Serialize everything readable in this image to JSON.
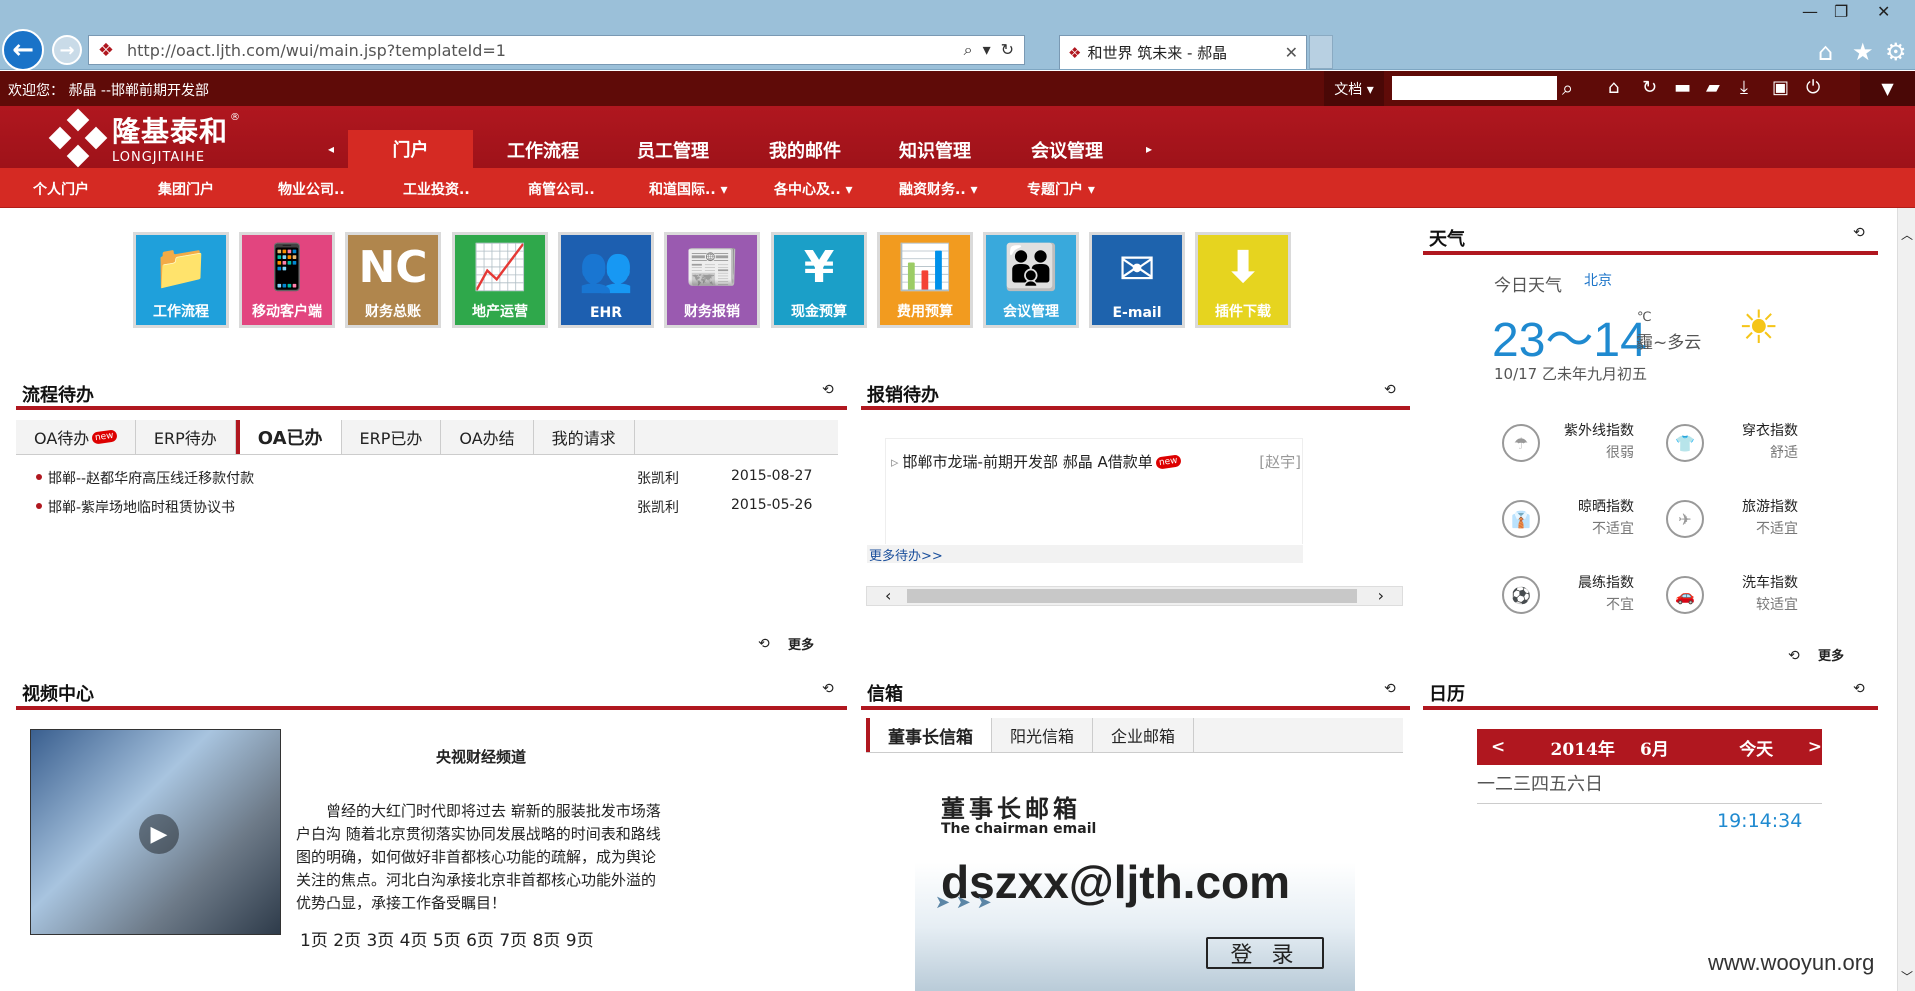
{
  "browser": {
    "url": "http://oact.ljth.com/wui/main.jsp?templateId=1",
    "tab_title": "和世界 筑未来 - 郝晶"
  },
  "topbar": {
    "welcome": "欢迎您： 郝晶 --邯郸前期开发部",
    "doc_menu": "文档 ▾"
  },
  "logo": {
    "cn": "隆基泰和",
    "en": "LONGJITAIHE",
    "reg": "®"
  },
  "nav": [
    "门户",
    "工作流程",
    "员工管理",
    "我的邮件",
    "知识管理",
    "会议管理"
  ],
  "subnav": [
    "个人门户",
    "集团门户",
    "物业公司..",
    "工业投资..",
    "商管公司..",
    "和道国际.. ▾",
    "各中心及.. ▾",
    "融资财务.. ▾",
    "专题门户 ▾"
  ],
  "apps": [
    {
      "label": "工作流程",
      "color": "#1fa0db",
      "glyph": "📁"
    },
    {
      "label": "移动客户端",
      "color": "#e2457f",
      "glyph": "📱"
    },
    {
      "label": "财务总账",
      "color": "#b0864d",
      "glyph": "NC"
    },
    {
      "label": "地产运营",
      "color": "#2fa84b",
      "glyph": "📈"
    },
    {
      "label": "EHR",
      "color": "#1d5fb0",
      "glyph": "👥"
    },
    {
      "label": "财务报销",
      "color": "#9a5ab0",
      "glyph": "📰"
    },
    {
      "label": "现金预算",
      "color": "#1b9fc8",
      "glyph": "¥"
    },
    {
      "label": "费用预算",
      "color": "#f29b1f",
      "glyph": "📊"
    },
    {
      "label": "会议管理",
      "color": "#39a9dc",
      "glyph": "👪"
    },
    {
      "label": "E-mail",
      "color": "#1e63ad",
      "glyph": "✉"
    },
    {
      "label": "插件下载",
      "color": "#e6d41f",
      "glyph": "⬇"
    }
  ],
  "flow": {
    "title": "流程待办",
    "tabs": [
      "OA待办",
      "ERP待办",
      "OA已办",
      "ERP已办",
      "OA办结",
      "我的请求"
    ],
    "new_badge": "new",
    "rows": [
      {
        "title": "邯郸--赵都华府高压线迁移款付款",
        "who": "张凯利",
        "date": "2015-08-27"
      },
      {
        "title": "邯郸-紫岸场地临时租赁协议书",
        "who": "张凯利",
        "date": "2015-05-26"
      }
    ],
    "more": "更多"
  },
  "reimb": {
    "title": "报销待办",
    "item": "邯郸市龙瑞-前期开发部 郝晶 A借款单",
    "new_badge": "new",
    "tag": "[赵宇]",
    "more": "更多待办>>"
  },
  "weather": {
    "title": "天气",
    "today": "今日天气",
    "city": "北京",
    "temp": "23～14",
    "unit": "℃",
    "desc": "霾~多云",
    "date": "10/17 乙未年九月初五",
    "indices": [
      {
        "name": "紫外线指数",
        "level": "很弱",
        "icon": "☂"
      },
      {
        "name": "穿衣指数",
        "level": "舒适",
        "icon": "👕"
      },
      {
        "name": "晾晒指数",
        "level": "不适宜",
        "icon": "👔"
      },
      {
        "name": "旅游指数",
        "level": "不适宜",
        "icon": "✈"
      },
      {
        "name": "晨练指数",
        "level": "不宜",
        "icon": "⚽"
      },
      {
        "name": "洗车指数",
        "level": "较适宜",
        "icon": "🚗"
      }
    ],
    "more": "更多"
  },
  "video": {
    "title": "视频中心",
    "channel": "央视财经频道",
    "text": "曾经的大红门时代即将过去 崭新的服装批发市场落户白沟 随着北京贯彻落实协同发展战略的时间表和路线图的明确，如何做好非首都核心功能的疏解，成为舆论关注的焦点。河北白沟承接北京非首都核心功能外溢的优势凸显，承接工作备受瞩目！",
    "pages": "1页 2页 3页 4页 5页 6页 7页 8页 9页"
  },
  "mail": {
    "title": "信箱",
    "tabs": [
      "董事长信箱",
      "阳光信箱",
      "企业邮箱"
    ],
    "box_cn": "董事长邮箱",
    "box_en": "The chairman email",
    "address": "dszxx@ljth.com",
    "login": "登 录"
  },
  "calendar": {
    "title": "日历",
    "prev": "<",
    "year": "2014年",
    "month": "6月",
    "today": "今天",
    "next": ">",
    "weekdays": "一二三四五六日",
    "time": "19:14:34"
  },
  "watermark": "www.wooyun.org"
}
